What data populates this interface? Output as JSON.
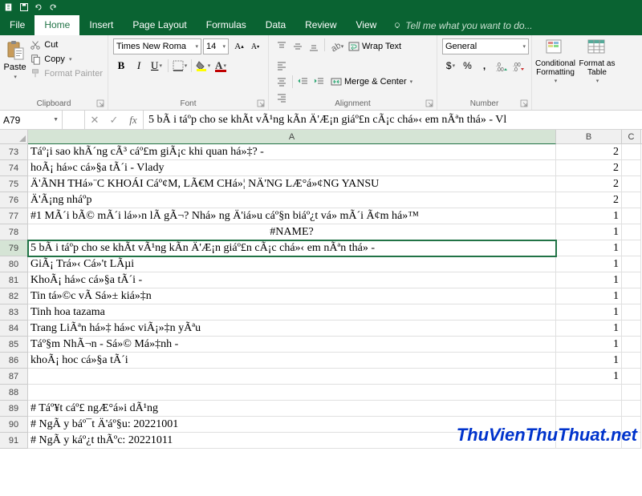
{
  "tabs": {
    "file": "File",
    "home": "Home",
    "insert": "Insert",
    "page_layout": "Page Layout",
    "formulas": "Formulas",
    "data": "Data",
    "review": "Review",
    "view": "View"
  },
  "tell_me": "Tell me what you want to do...",
  "ribbon": {
    "clipboard": {
      "label": "Clipboard",
      "paste": "Paste",
      "cut": "Cut",
      "copy": "Copy",
      "format_painter": "Format Painter"
    },
    "font": {
      "label": "Font",
      "name": "Times New Roma",
      "size": "14"
    },
    "alignment": {
      "label": "Alignment",
      "wrap": "Wrap Text",
      "merge": "Merge & Center"
    },
    "number": {
      "label": "Number",
      "format": "General"
    },
    "styles": {
      "cond": "Conditional Formatting",
      "table": "Format as Table"
    }
  },
  "namebox": "A79",
  "formula": "5 bÃ i táº­p cho se khÃ­t vÃ¹ng kÃ­n Ä'Æ¡n giáº£n cÃ¡c chá»‹ em nÃªn thá»­ - Vl",
  "cols": {
    "A": "A",
    "B": "B",
    "C": "C"
  },
  "rows": [
    {
      "n": "73",
      "A": "Táº¡i sao khÃ´ng cÃ³ cáº£m giÃ¡c khi quan há»‡? -",
      "B": "2"
    },
    {
      "n": "74",
      "A": "hoÃ¡ há»c cá»§a tÃ´i - Vlady",
      "B": "2"
    },
    {
      "n": "75",
      "A": "Ä'ÃNH THá»¨C KHOÁI Cáº¢M, LÃ€M CHá»¦ NÄ'NG LÆ°á»¢NG YANSU",
      "B": "2"
    },
    {
      "n": "76",
      "A": "Ä'Ã¡ng nháº­p",
      "B": "2"
    },
    {
      "n": "77",
      "A": "#1 MÃ´i bÃ© mÃ´i lá»›n lÃ  gÃ¬? Nhá» ng Ä'iá»u cáº§n biáº¿t vá» mÃ´i Ã¢m há»™",
      "B": "1"
    },
    {
      "n": "78",
      "A": "#NAME?",
      "B": "1",
      "center": true
    },
    {
      "n": "79",
      "A": "5 bÃ i táº­p cho se khÃ­t vÃ¹ng kÃ­n Ä'Æ¡n giáº£n cÃ¡c chá»‹ em nÃªn thá»­ -",
      "B": "1",
      "selected": true
    },
    {
      "n": "80",
      "A": "GiÃ¡ Trá»‹ Cá»'t LÃµi",
      "B": "1"
    },
    {
      "n": "81",
      "A": "KhoÃ¡ há»c cá»§a tÃ´i -",
      "B": "1"
    },
    {
      "n": "82",
      "A": "Tin tá»©c vÃ  Sá»± kiá»‡n",
      "B": "1"
    },
    {
      "n": "83",
      "A": "Tinh hoa tazama",
      "B": "1"
    },
    {
      "n": "84",
      "A": "Trang LiÃªn há»‡ há»c viÃ¡»‡n yÃªu",
      "B": "1"
    },
    {
      "n": "85",
      "A": "Táº§m NhÃ¬n - Sá»© Má»‡nh -",
      "B": "1"
    },
    {
      "n": "86",
      "A": "khoÃ¡ hoc cá»§a tÃ´i",
      "B": "1"
    },
    {
      "n": "87",
      "A": "",
      "B": "1"
    },
    {
      "n": "88",
      "A": "",
      "B": ""
    },
    {
      "n": "89",
      "A": "# Táº¥t cáº£ ngÆ°á»i dÃ¹ng",
      "B": ""
    },
    {
      "n": "90",
      "A": "# NgÃ y báº¯t Ä'áº§u: 20221001",
      "B": ""
    },
    {
      "n": "91",
      "A": "# NgÃ y káº¿t thÃºc: 20221011",
      "B": ""
    }
  ],
  "watermark": "ThuVienThuThuat.net"
}
